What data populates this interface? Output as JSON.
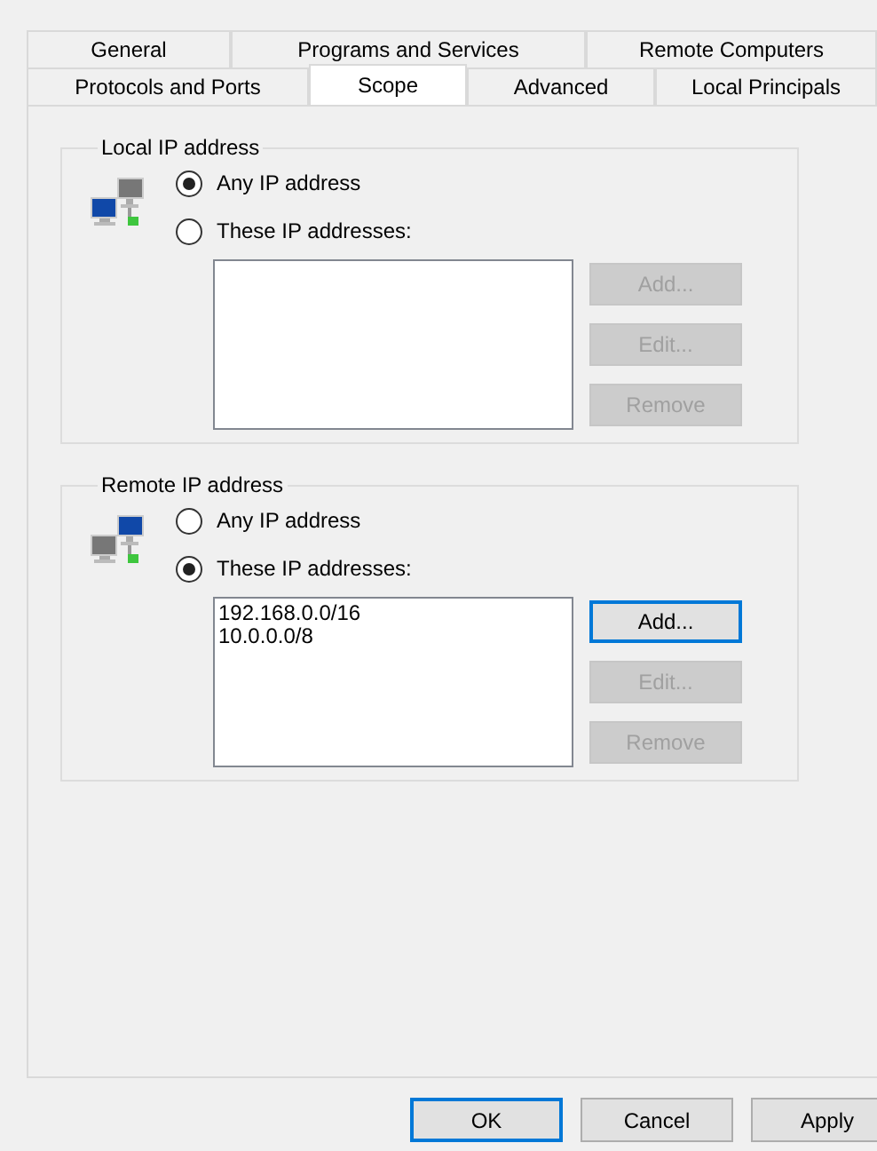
{
  "tab_rows": [
    [
      {
        "label": "General",
        "selected": false
      },
      {
        "label": "Programs and Services",
        "selected": false
      },
      {
        "label": "Remote Computers",
        "selected": false
      }
    ],
    [
      {
        "label": "Protocols and Ports",
        "selected": false
      },
      {
        "label": "Scope",
        "selected": true
      },
      {
        "label": "Advanced",
        "selected": false
      },
      {
        "label": "Local Principals",
        "selected": false
      }
    ]
  ],
  "groups": [
    {
      "title": "Local IP address",
      "kind": "local",
      "options": [
        {
          "label": "Any IP address",
          "selected": true
        },
        {
          "label": "These IP addresses:",
          "selected": false
        }
      ],
      "buttons": [
        {
          "label": "Add...",
          "disabled": true,
          "default": false
        },
        {
          "label": "Edit...",
          "disabled": true,
          "default": false
        },
        {
          "label": "Remove",
          "disabled": true,
          "default": false
        }
      ]
    },
    {
      "title": "Remote IP address",
      "kind": "remote",
      "options": [
        {
          "label": "Any IP address",
          "selected": false
        },
        {
          "label": "These IP addresses:",
          "selected": true
        }
      ],
      "addresses": [
        "192.168.0.0/16",
        "10.0.0.0/8"
      ],
      "buttons": [
        {
          "label": "Add...",
          "disabled": false,
          "default": true
        },
        {
          "label": "Edit...",
          "disabled": true,
          "default": false
        },
        {
          "label": "Remove",
          "disabled": true,
          "default": false
        }
      ]
    }
  ],
  "dialog_buttons": [
    {
      "label": "OK",
      "default": true
    },
    {
      "label": "Cancel",
      "default": false
    },
    {
      "label": "Apply",
      "default": false
    }
  ]
}
